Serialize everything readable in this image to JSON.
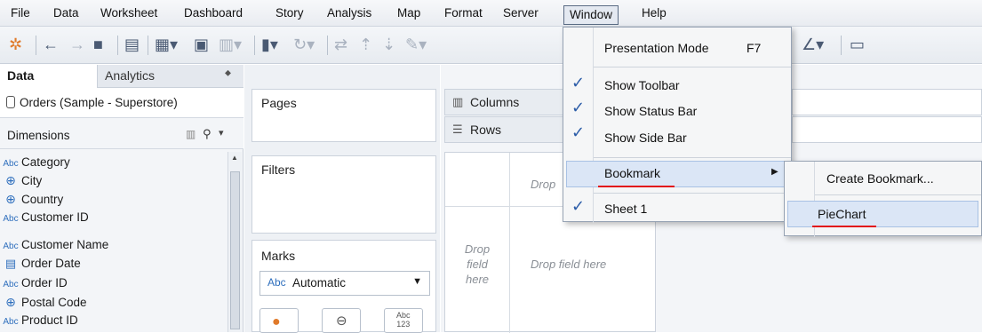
{
  "menubar": {
    "items": [
      "File",
      "Data",
      "Worksheet",
      "Dashboard",
      "Story",
      "Analysis",
      "Map",
      "Format",
      "Server",
      "Window",
      "Help"
    ]
  },
  "toolbar": {
    "icons": [
      "tableau-logo-icon",
      "back-icon",
      "forward-icon",
      "save-icon",
      "add-datasource-icon",
      "new-sheet-icon",
      "duplicate-sheet-icon",
      "clear-sheet-icon",
      "pause-icon",
      "refresh-icon",
      "swap-icon",
      "sort-asc-icon",
      "sort-desc-icon",
      "highlight-icon",
      "pen-icon",
      "present-icon"
    ]
  },
  "data_pane": {
    "tabs": {
      "data": "Data",
      "analytics": "Analytics"
    },
    "datasource": "Orders (Sample - Superstore)",
    "dimensions_label": "Dimensions",
    "fields": [
      {
        "type": "Abc",
        "name": "Category"
      },
      {
        "type": "geo",
        "name": "City"
      },
      {
        "type": "geo",
        "name": "Country"
      },
      {
        "type": "Abc",
        "name": "Customer ID"
      },
      {
        "type": "Abc",
        "name": "Customer Name"
      },
      {
        "type": "date",
        "name": "Order Date"
      },
      {
        "type": "Abc",
        "name": "Order ID"
      },
      {
        "type": "geo",
        "name": "Postal Code"
      },
      {
        "type": "Abc",
        "name": "Product ID"
      }
    ]
  },
  "cards": {
    "pages": "Pages",
    "filters": "Filters",
    "marks": "Marks",
    "marks_type": "Automatic",
    "marks_type_prefix": "Abc",
    "text_btn": "Abc\n123"
  },
  "canvas": {
    "columns": "Columns",
    "rows": "Rows",
    "drop_top": "Drop field here",
    "drop_left": "Drop\nfield\nhere",
    "drop_main": "Drop field here",
    "drop_partial": "Drop"
  },
  "window_menu": {
    "presentation_mode": "Presentation Mode",
    "presentation_shortcut": "F7",
    "show_toolbar": "Show Toolbar",
    "show_status_bar": "Show Status Bar",
    "show_side_bar": "Show Side Bar",
    "bookmark": "Bookmark",
    "sheet1": "Sheet 1"
  },
  "bookmark_menu": {
    "create": "Create Bookmark...",
    "item": "PieChart"
  },
  "colors": {
    "check": "#2b5ca8",
    "underline": "#e2141b",
    "field_icon": "#2f6fbd"
  }
}
